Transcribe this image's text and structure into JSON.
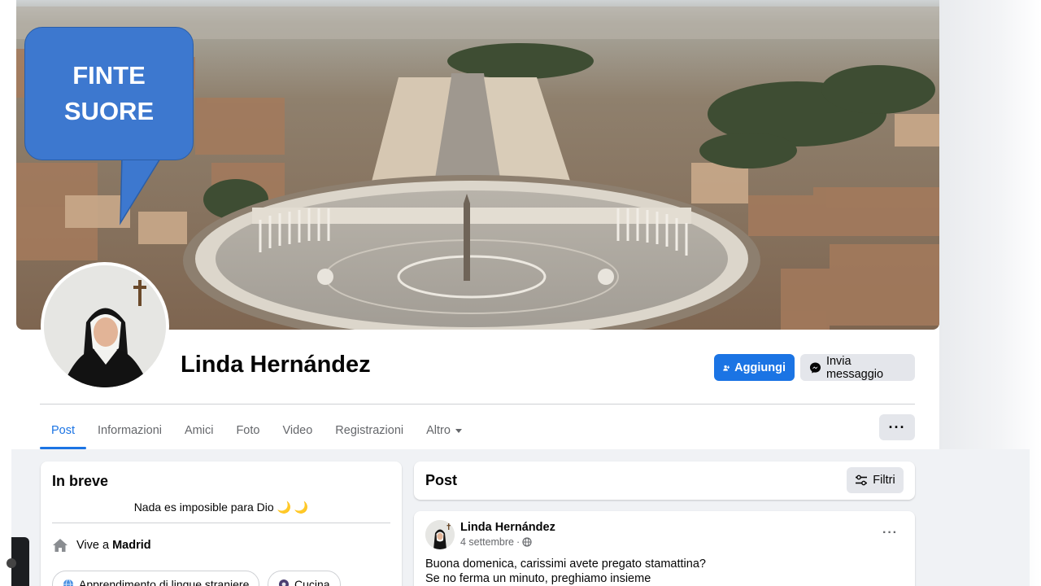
{
  "overlay": {
    "line1": "FINTE",
    "line2": "SUORE"
  },
  "profile": {
    "name": "Linda Hernández"
  },
  "actions": {
    "add_label": "Aggiungi",
    "message_label": "Invia messaggio"
  },
  "tabs": [
    {
      "label": "Post"
    },
    {
      "label": "Informazioni"
    },
    {
      "label": "Amici"
    },
    {
      "label": "Foto"
    },
    {
      "label": "Video"
    },
    {
      "label": "Registrazioni"
    },
    {
      "label": "Altro"
    }
  ],
  "intro": {
    "title": "In breve",
    "bio": "Nada es imposible para Dio 🌙 🌙",
    "lives_prefix": "Vive a",
    "lives_city": "Madrid",
    "interests": [
      "Apprendimento di lingue straniere",
      "Cucina"
    ]
  },
  "posts_header": {
    "title": "Post",
    "filter_label": "Filtri"
  },
  "post": {
    "author": "Linda Hernández",
    "date": "4 settembre",
    "line1": "Buona domenica, carissimi avete pregato stamattina?",
    "line2": "Se no ferma un minuto, preghiamo insieme"
  },
  "colors": {
    "accent": "#1b74e4",
    "callout": "#3d78cf"
  }
}
